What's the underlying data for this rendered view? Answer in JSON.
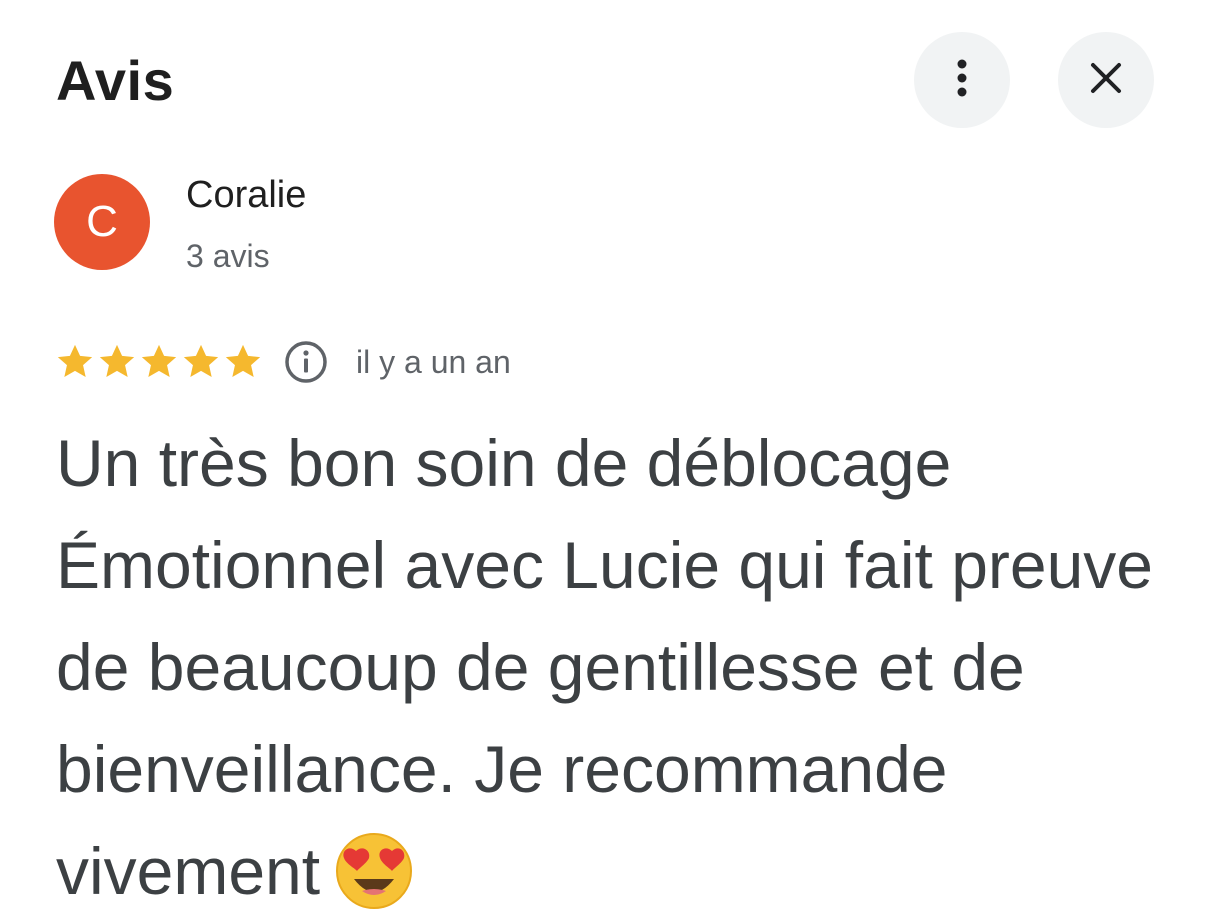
{
  "header": {
    "title": "Avis",
    "more_icon": "more-vert-icon",
    "close_icon": "close-icon"
  },
  "author": {
    "initial": "C",
    "name": "Coralie",
    "meta": "3 avis",
    "avatar_color": "#e8542f"
  },
  "rating": {
    "stars": 5,
    "max_stars": 5,
    "star_color": "#f5b82e",
    "time": "il y a un an",
    "info_icon": "info-icon"
  },
  "review": {
    "text": "Un très bon soin de déblocage Émotionnel avec Lucie qui fait preuve de beaucoup de gentillesse et de bienveillance. Je recommande vivement",
    "emoji": "heart-eyes-emoji"
  },
  "colors": {
    "title": "#1f1f1f",
    "secondary_text": "#5f6368",
    "body_text": "#3c4043",
    "button_bg": "#f1f3f4"
  }
}
